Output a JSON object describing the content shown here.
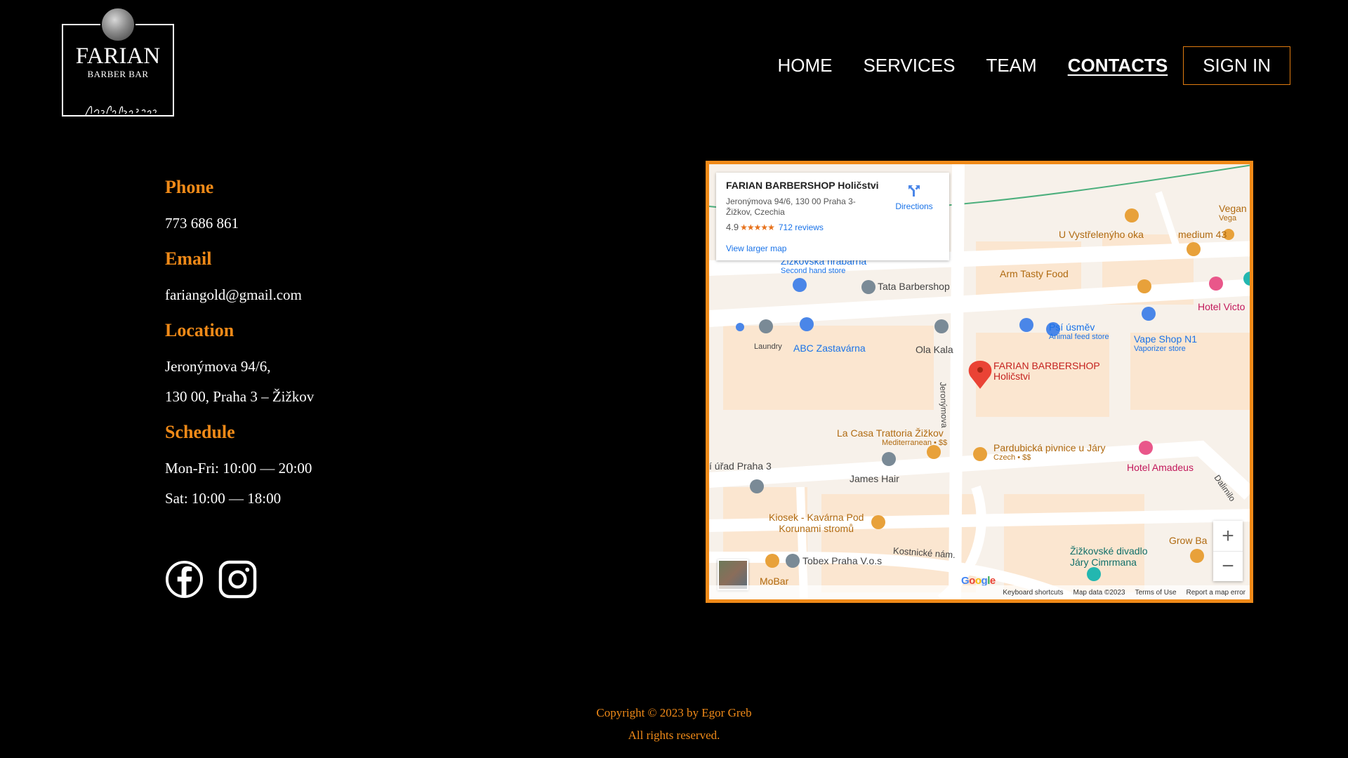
{
  "logo": {
    "title": "FARIAN",
    "subtitle": "BARBER BAR",
    "tagline": "from father to son"
  },
  "nav": {
    "items": [
      {
        "label": "HOME"
      },
      {
        "label": "SERVICES"
      },
      {
        "label": "TEAM"
      },
      {
        "label": "CONTACTS",
        "active": true
      }
    ],
    "signin": "SIGN IN"
  },
  "contacts": {
    "phone_heading": "Phone",
    "phone": "773 686 861",
    "email_heading": "Email",
    "email": "fariangold@gmail.com",
    "location_heading": "Location",
    "address_line1": "Jeronýmova 94/6,",
    "address_line2": "130 00, Praha 3 – Žižkov",
    "schedule_heading": "Schedule",
    "schedule_weekdays": "Mon-Fri: 10:00 — 20:00",
    "schedule_saturday": "Sat: 10:00 — 18:00"
  },
  "social": [
    "facebook-icon",
    "instagram-icon"
  ],
  "map": {
    "place_name": "FARIAN BARBERSHOP Holičstvi",
    "address": "Jeronýmova 94/6, 130 00 Praha 3-Žižkov, Czechia",
    "rating": "4.9",
    "reviews": "712 reviews",
    "directions": "Directions",
    "view_larger": "View larger map",
    "pois": {
      "zizkovska": "Žižkovská hrabárna",
      "zizkovska_sub": "Second hand store",
      "tata": "Tata Barbershop",
      "arm": "Arm Tasty Food",
      "vystreleny": "U Vystřelenýho oka",
      "medium": "medium 43",
      "vegan": "Vegan",
      "vegan_sub": "Vega",
      "victoria": "Hotel Victo",
      "laundry": "Laundry",
      "abc": "ABC Zastavárna",
      "ola": "Ola Kala",
      "psi": "Psí úsměv",
      "psi_sub": "Animal feed store",
      "vape": "Vape Shop N1",
      "vape_sub": "Vaporizer store",
      "farian": "FARIAN BARBERSHOP",
      "farian2": "Holičstvi",
      "street_jer": "Jeronýmova",
      "lacasa": "La Casa Trattoria Žižkov",
      "lacasa_sub": "Mediterranean • $$",
      "pardubicka": "Pardubická pivnice u Járy",
      "pardubicka_sub": "Czech • $$",
      "amadeus": "Hotel Amadeus",
      "urad": "í úřad Praha 3",
      "james": "James Hair",
      "kiosek1": "Kiosek - Kavárna Pod",
      "kiosek2": "Korunami stromů",
      "dalimil": "Dalimilo",
      "kostnicke": "Kostnické nám.",
      "tobex": "Tobex Praha V.o.s",
      "divadlo1": "Žižkovské divadlo",
      "divadlo2": "Járy Cimrmana",
      "growba": "Grow Ba",
      "mobar": "MoBar"
    },
    "google": "Google",
    "attribution": [
      "Keyboard shortcuts",
      "Map data ©2023",
      "Terms of Use",
      "Report a map error"
    ]
  },
  "footer": {
    "copyright": "Copyright © 2023 by Egor Greb",
    "rights": "All rights reserved."
  },
  "colors": {
    "accent": "#f08a18",
    "background": "#000000"
  }
}
